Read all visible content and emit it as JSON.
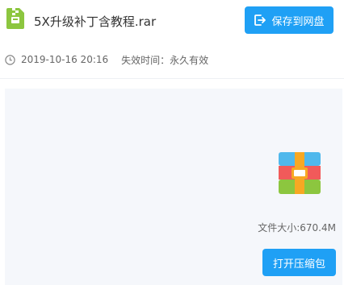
{
  "header": {
    "file_name": "5X升级补丁含教程.rar",
    "file_icon": "zip-file-icon",
    "save_button_label": "保存到网盘",
    "save_icon": "save-to-disk-icon"
  },
  "meta": {
    "clock_icon": "clock-icon",
    "date": "2019-10-16 20:16",
    "expire_label": "失效时间：永久有效"
  },
  "preview": {
    "archive_icon": "archive-icon",
    "file_size": "文件大小:670.4M",
    "open_button_label": "打开压缩包"
  },
  "colors": {
    "accent": "#1fa0f5",
    "file_icon_green": "#8cc63f",
    "panel_bg": "#f5f7fb"
  }
}
